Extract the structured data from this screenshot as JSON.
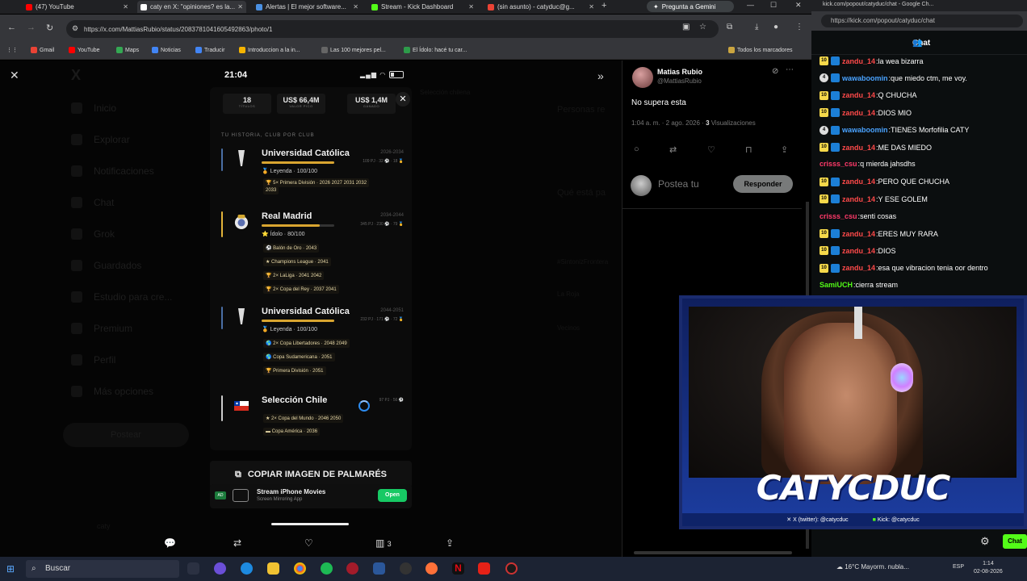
{
  "browser": {
    "tabs": [
      {
        "label": "(47) YouTube",
        "color": "#ff0000"
      },
      {
        "label": "caty en X: \"opiniones? es la...",
        "color": "#ffffff"
      },
      {
        "label": "Alertas | El mejor software...",
        "color": "#4a90e2"
      },
      {
        "label": "Stream - Kick Dashboard",
        "color": "#53fc18"
      },
      {
        "label": "(sin asunto) - catyduc@g...",
        "color": "#ea4335"
      }
    ],
    "gemini": "Pregunta a Gemini",
    "url": "https://x.com/MattiasRubio/status/2083781041605492863/photo/1",
    "bookmarks": [
      "Gmail",
      "YouTube",
      "Maps",
      "Noticias",
      "Traducir",
      "Introduccion a la in...",
      "Las 100 mejores pel...",
      "El Ídolo: hacé tu car..."
    ],
    "all_bookmarks": "Todos los marcadores"
  },
  "x_nav": {
    "items": [
      "Inicio",
      "Explorar",
      "Notificaciones",
      "Chat",
      "Grok",
      "Guardados",
      "Estudio para cre...",
      "Premium",
      "Perfil",
      "Más opciones"
    ],
    "post": "Postear",
    "ghost_texts": [
      "Personas re",
      "Qué está pa",
      "Selección chilena",
      "Entrada de búsqueda",
      "#SintonizFrontera",
      "La Roja",
      "Vecinos",
      "caty",
      "@caty"
    ]
  },
  "phone": {
    "time": "21:04",
    "stats": [
      {
        "value": "18",
        "label": "TÍTULOS"
      },
      {
        "value": "US$ 66,4M",
        "label": "VALOR PICO"
      },
      {
        "value": "US$ 1,4M",
        "label": "GANADO"
      }
    ],
    "history_title": "TU HISTORIA, CLUB POR CLUB",
    "clubs": [
      {
        "name": "Universidad Católica",
        "years": "2026-2034",
        "stats": "109 PJ · 32 ⚽ · 18 🥇",
        "rank": "Leyenda · 100/100",
        "progress": 1.0,
        "titles": [
          "5× Primera División · 2026 2027 2031 2032",
          "2033"
        ]
      },
      {
        "name": "Real Madrid",
        "years": "2034-2044",
        "stats": "345 PJ · 230 ⚽ · 79 🥇",
        "rank": "Ídolo · 80/100",
        "progress": 0.8,
        "titles": [
          "Balón de Oro · 2043",
          "Champions League · 2041",
          "2× LaLiga · 2041 2042",
          "2× Copa del Rey · 2037 2041"
        ]
      },
      {
        "name": "Universidad Católica",
        "years": "2044-2051",
        "stats": "232 PJ · 171 ⚽ · 72 🥇",
        "rank": "Leyenda · 100/100",
        "progress": 1.0,
        "titles": [
          "2× Copa Libertadores · 2048 2049",
          "Copa Sudamericana · 2051",
          "Primera División · 2051"
        ]
      },
      {
        "name": "Selección Chile",
        "years": "",
        "stats": "97 PJ · 56 ⚽",
        "rank": "",
        "progress": 0,
        "titles": [
          "2× Copa del Mundo · 2046 2050",
          "Copa América · 2036"
        ]
      }
    ],
    "copy_button": "COPIAR IMAGEN DE PALMARÉS",
    "ad": {
      "badge": "AD",
      "title": "Stream iPhone Movies",
      "subtitle": "Screen Mirroring App",
      "button": "Open"
    }
  },
  "bottom_actions": {
    "views": "3"
  },
  "tweet": {
    "name": "Matias Rubio",
    "handle": "@MattiasRubio",
    "text": "No supera esta",
    "meta_time": "1:04 a. m. · 2 ago. 2026 · ",
    "meta_views_count": "3",
    "meta_views_label": " Visualizaciones",
    "reply_placeholder": "Postea tu",
    "reply_button": "Responder"
  },
  "kick": {
    "tab": "kick.com/popout/catyduc/chat - Google Ch...",
    "url": "https://kick.com/popout/catyduc/chat",
    "header": "Chat",
    "messages": [
      {
        "badge": "10",
        "user": "zandu_14",
        "color": "#ff4a4a",
        "text": "la wea bizarra"
      },
      {
        "badge": "4",
        "user": "wawaboomin",
        "color": "#4aa3ff",
        "text": "que miedo ctm, me voy."
      },
      {
        "badge": "10",
        "user": "zandu_14",
        "color": "#ff4a4a",
        "text": "Q CHUCHA"
      },
      {
        "badge": "10",
        "user": "zandu_14",
        "color": "#ff4a4a",
        "text": "DIOS MIO"
      },
      {
        "badge": "4",
        "user": "wawaboomin",
        "color": "#4aa3ff",
        "text": "TIENES Morfofilia CATY"
      },
      {
        "badge": "10",
        "user": "zandu_14",
        "color": "#ff4a4a",
        "text": "ME DAS MIEDO"
      },
      {
        "badge": "",
        "user": "crisss_csu",
        "color": "#ff3a6a",
        "text": "q mierda jahsdhs"
      },
      {
        "badge": "10",
        "user": "zandu_14",
        "color": "#ff4a4a",
        "text": "PERO QUE CHUCHA"
      },
      {
        "badge": "10",
        "user": "zandu_14",
        "color": "#ff4a4a",
        "text": "Y ESE GOLEM"
      },
      {
        "badge": "",
        "user": "crisss_csu",
        "color": "#ff3a6a",
        "text": "senti cosas"
      },
      {
        "badge": "10",
        "user": "zandu_14",
        "color": "#ff4a4a",
        "text": "ERES MUY RARA"
      },
      {
        "badge": "10",
        "user": "zandu_14",
        "color": "#ff4a4a",
        "text": "DIOS"
      },
      {
        "badge": "10",
        "user": "zandu_14",
        "color": "#ff4a4a",
        "text": "esa que vibracion tenia oor dentro"
      },
      {
        "badge": "",
        "user": "SamiUCH",
        "color": "#53fc18",
        "text": "cierra stream"
      }
    ],
    "cam_name": "CATYCDUC",
    "cam_twitter": "X (twitter): @catycduc",
    "cam_kick": "Kick: @catycduc",
    "chat_button": "Chat"
  },
  "taskbar": {
    "search": "Buscar",
    "weather": "16°C  Mayorm. nubla...",
    "lang": "ESP",
    "time": "1:14",
    "date": "02-08-2026"
  }
}
